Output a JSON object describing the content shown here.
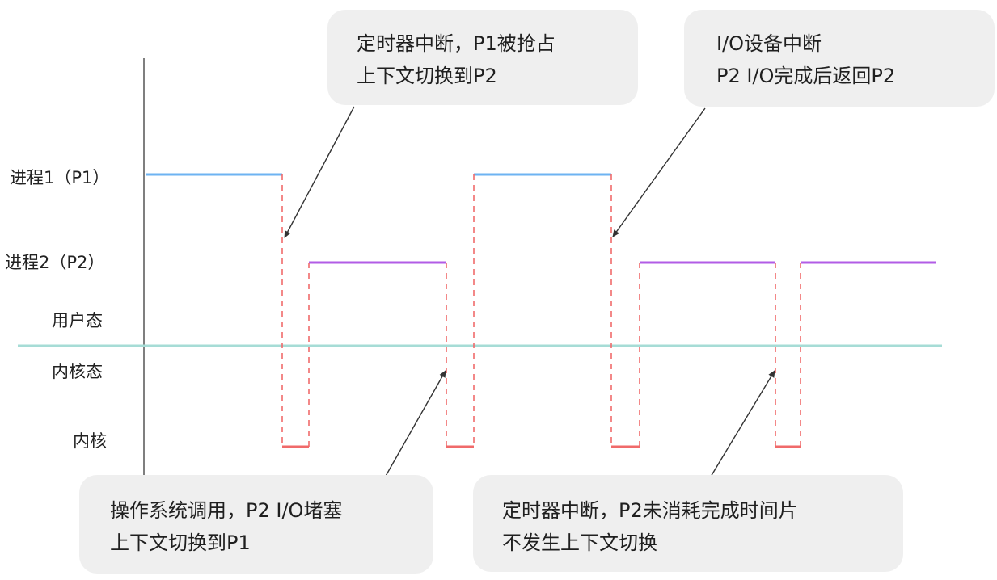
{
  "labels": {
    "p1": "进程1（P1）",
    "p2": "进程2（P2）",
    "user_mode": "用户态",
    "kernel_mode": "内核态",
    "kernel": "内核"
  },
  "callouts": {
    "timer_preempt": {
      "line1": "定时器中断，P1被抢占",
      "line2": "上下文切换到P2"
    },
    "io_interrupt": {
      "line1": "I/O设备中断",
      "line2": "P2 I/O完成后返回P2"
    },
    "syscall_block": {
      "line1": "操作系统调用，P2 I/O堵塞",
      "line2": "上下文切换到P1"
    },
    "timer_no_switch": {
      "line1": "定时器中断，P2未消耗完成时间片",
      "line2": "不发生上下文切换"
    }
  },
  "colors": {
    "p1_line": "#6db3f2",
    "p2_line": "#b25ce6",
    "kernel_segment": "#f06a6a",
    "transition_dashed": "#f06a6a",
    "mode_boundary": "#a6dcd6",
    "axis": "#555555",
    "arrow": "#333333",
    "callout_bg": "#efefef"
  }
}
